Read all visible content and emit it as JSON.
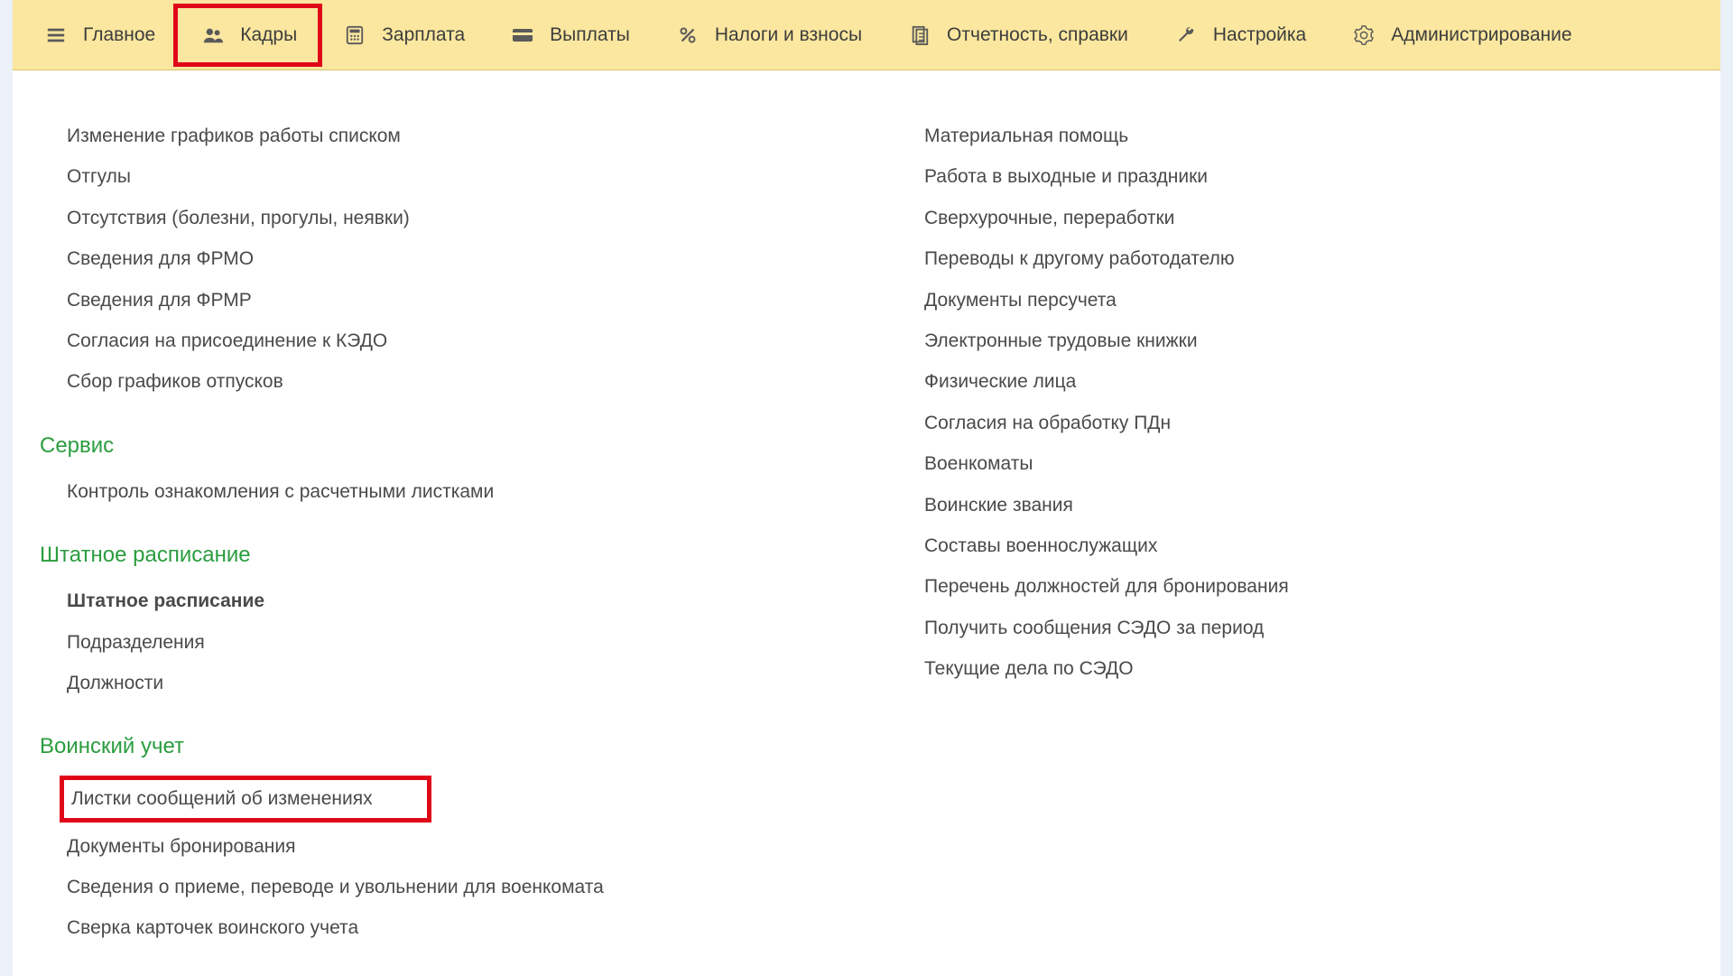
{
  "toolbar": [
    {
      "id": "main",
      "name": "tb-main",
      "icon": "menu-icon",
      "label": "Главное"
    },
    {
      "id": "kadry",
      "name": "tb-kadry",
      "icon": "people-icon",
      "label": "Кадры",
      "active": true
    },
    {
      "id": "zarplata",
      "name": "tb-zarplata",
      "icon": "calc-icon",
      "label": "Зарплата"
    },
    {
      "id": "vyplaty",
      "name": "tb-vyplaty",
      "icon": "wallet-icon",
      "label": "Выплаты"
    },
    {
      "id": "nalogi",
      "name": "tb-nalogi",
      "icon": "percent-icon",
      "label": "Налоги и взносы"
    },
    {
      "id": "otchet",
      "name": "tb-otchet",
      "icon": "report-icon",
      "label": "Отчетность, справки"
    },
    {
      "id": "nastroy",
      "name": "tb-nastroy",
      "icon": "wrench-icon",
      "label": "Настройка"
    },
    {
      "id": "admin",
      "name": "tb-admin",
      "icon": "gear-icon",
      "label": "Администрирование"
    }
  ],
  "left": {
    "top_links": [
      "Изменение графиков работы списком",
      "Отгулы",
      "Отсутствия (болезни, прогулы, неявки)",
      "Сведения для ФРМО",
      "Сведения для ФРМР",
      "Согласия на присоединение к КЭДО",
      "Сбор графиков отпусков"
    ],
    "section_service_title": "Сервис",
    "service_links": [
      "Контроль ознакомления с расчетными листками"
    ],
    "section_staff_title": "Штатное расписание",
    "staff_links": [
      {
        "label": "Штатное расписание",
        "bold": true
      },
      {
        "label": "Подразделения"
      },
      {
        "label": "Должности"
      }
    ],
    "section_military_title": "Воинский учет",
    "military_links": [
      {
        "label": "Листки сообщений об изменениях",
        "highlight": true
      },
      {
        "label": "Документы бронирования"
      },
      {
        "label": "Сведения о приеме, переводе и увольнении для военкомата"
      },
      {
        "label": "Сверка карточек воинского учета"
      }
    ]
  },
  "right": {
    "links": [
      "Материальная помощь",
      "Работа в выходные и праздники",
      "Сверхурочные, переработки",
      "Переводы к другому работодателю",
      "Документы персучета",
      "Электронные трудовые книжки",
      "Физические лица",
      "Согласия на обработку ПДн",
      "Военкоматы",
      "Воинские звания",
      "Составы военнослужащих",
      "Перечень должностей для бронирования",
      "Получить сообщения СЭДО за период",
      "Текущие дела по СЭДО"
    ]
  }
}
